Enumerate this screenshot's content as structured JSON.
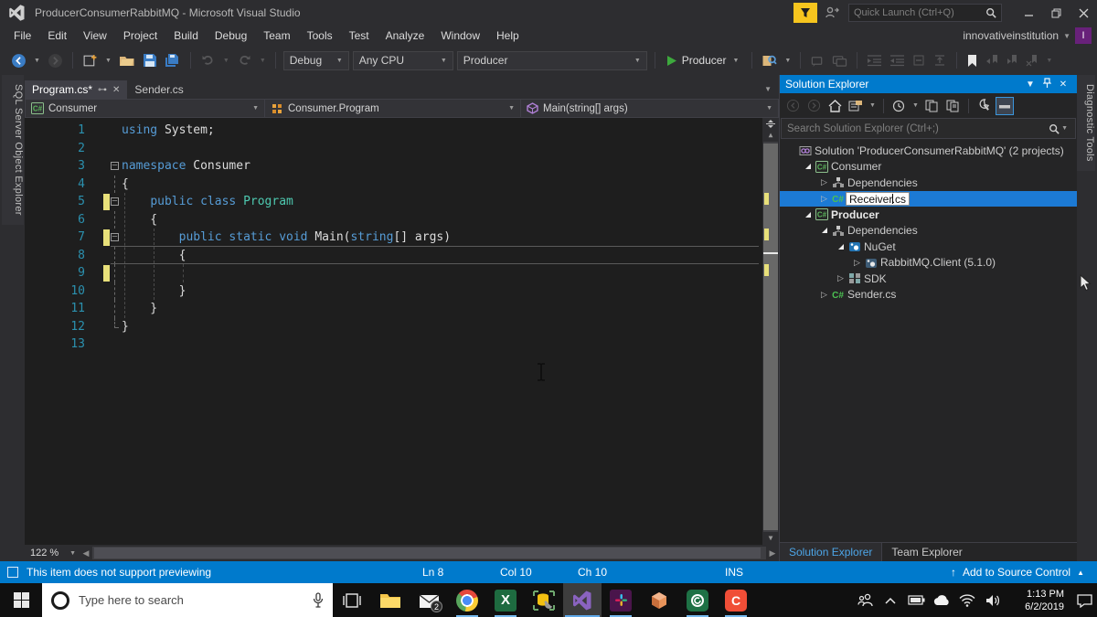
{
  "colors": {
    "accent_blue": "#007ACC",
    "selection_blue": "#1C7AD4",
    "keyword": "#569CD6",
    "type_name": "#4EC9B0",
    "line_number": "#2B91AF",
    "change_bar": "#E8E07A",
    "editor_bg": "#1E1E1E"
  },
  "title_bar": {
    "app_title": "ProducerConsumerRabbitMQ - Microsoft Visual Studio",
    "quick_launch_placeholder": "Quick Launch (Ctrl+Q)"
  },
  "menu_bar": {
    "items": [
      "File",
      "Edit",
      "View",
      "Project",
      "Build",
      "Debug",
      "Team",
      "Tools",
      "Test",
      "Analyze",
      "Window",
      "Help"
    ],
    "account": "innovativeinstitution",
    "avatar_letter": "I"
  },
  "toolbar": {
    "configuration": "Debug",
    "platform": "Any CPU",
    "startup_project": "Producer",
    "run_button": "Producer"
  },
  "left_strip": {
    "tab": "SQL Server Object Explorer"
  },
  "right_strip": {
    "tab": "Diagnostic Tools"
  },
  "editor": {
    "tabs": [
      {
        "label": "Program.cs*",
        "active": true
      },
      {
        "label": "Sender.cs",
        "active": false
      }
    ],
    "navbar": {
      "project": "Consumer",
      "type": "Consumer.Program",
      "member": "Main(string[] args)"
    },
    "zoom_level": "122 %",
    "code": {
      "lines": [
        {
          "n": 1,
          "fold": "",
          "changed": false,
          "current": false,
          "segments": [
            {
              "t": "using ",
              "c": "kw"
            },
            {
              "t": "System;",
              "c": "pl"
            }
          ]
        },
        {
          "n": 2,
          "fold": "",
          "changed": false,
          "current": false,
          "segments": []
        },
        {
          "n": 3,
          "fold": "box",
          "changed": false,
          "current": false,
          "segments": [
            {
              "t": "namespace ",
              "c": "kw"
            },
            {
              "t": "Consumer",
              "c": "pl"
            }
          ]
        },
        {
          "n": 4,
          "fold": "line",
          "changed": false,
          "current": false,
          "segments": [
            {
              "t": "{",
              "c": "pl"
            }
          ]
        },
        {
          "n": 5,
          "fold": "box",
          "changed": true,
          "current": false,
          "segments": [
            {
              "t": "    ",
              "c": "pl"
            },
            {
              "t": "public class ",
              "c": "kw"
            },
            {
              "t": "Program",
              "c": "ty"
            }
          ]
        },
        {
          "n": 6,
          "fold": "line",
          "changed": false,
          "current": false,
          "segments": [
            {
              "t": "    {",
              "c": "pl"
            }
          ]
        },
        {
          "n": 7,
          "fold": "box",
          "changed": true,
          "current": false,
          "segments": [
            {
              "t": "        ",
              "c": "pl"
            },
            {
              "t": "public static void ",
              "c": "kw"
            },
            {
              "t": "Main(",
              "c": "pl"
            },
            {
              "t": "string",
              "c": "kw"
            },
            {
              "t": "[] args)",
              "c": "pl"
            }
          ]
        },
        {
          "n": 8,
          "fold": "line",
          "changed": false,
          "current": true,
          "segments": [
            {
              "t": "        {",
              "c": "pl"
            }
          ]
        },
        {
          "n": 9,
          "fold": "line",
          "changed": true,
          "current": false,
          "segments": []
        },
        {
          "n": 10,
          "fold": "line",
          "changed": false,
          "current": false,
          "segments": [
            {
              "t": "        }",
              "c": "pl"
            }
          ]
        },
        {
          "n": 11,
          "fold": "line",
          "changed": false,
          "current": false,
          "segments": [
            {
              "t": "    }",
              "c": "pl"
            }
          ]
        },
        {
          "n": 12,
          "fold": "end",
          "changed": false,
          "current": false,
          "segments": [
            {
              "t": "}",
              "c": "pl"
            }
          ]
        },
        {
          "n": 13,
          "fold": "",
          "changed": false,
          "current": false,
          "segments": []
        }
      ]
    }
  },
  "solution_explorer": {
    "title": "Solution Explorer",
    "search_placeholder": "Search Solution Explorer (Ctrl+;)",
    "tree": [
      {
        "label": "Solution 'ProducerConsumerRabbitMQ' (2 projects)",
        "indent": 0,
        "arrow": "none",
        "icon": "solution",
        "selected": false,
        "editing": false,
        "bold": false
      },
      {
        "label": "Consumer",
        "indent": 1,
        "arrow": "expanded",
        "icon": "csproj",
        "selected": false,
        "editing": false,
        "bold": false
      },
      {
        "label": "Dependencies",
        "indent": 2,
        "arrow": "collapsed",
        "icon": "dependencies",
        "selected": false,
        "editing": false,
        "bold": false
      },
      {
        "label": "Receiver.cs",
        "indent": 2,
        "arrow": "collapsed",
        "icon": "csfile",
        "selected": true,
        "editing": true,
        "bold": false
      },
      {
        "label": "Producer",
        "indent": 1,
        "arrow": "expanded",
        "icon": "csproj",
        "selected": false,
        "editing": false,
        "bold": true
      },
      {
        "label": "Dependencies",
        "indent": 2,
        "arrow": "expanded",
        "icon": "dependencies",
        "selected": false,
        "editing": false,
        "bold": false
      },
      {
        "label": "NuGet",
        "indent": 3,
        "arrow": "expanded",
        "icon": "nuget",
        "selected": false,
        "editing": false,
        "bold": false
      },
      {
        "label": "RabbitMQ.Client (5.1.0)",
        "indent": 4,
        "arrow": "collapsed",
        "icon": "package",
        "selected": false,
        "editing": false,
        "bold": false
      },
      {
        "label": "SDK",
        "indent": 3,
        "arrow": "collapsed",
        "icon": "sdk",
        "selected": false,
        "editing": false,
        "bold": false
      },
      {
        "label": "Sender.cs",
        "indent": 2,
        "arrow": "collapsed",
        "icon": "csfile",
        "selected": false,
        "editing": false,
        "bold": false
      }
    ],
    "bottom_tabs": [
      {
        "label": "Solution Explorer",
        "active": true
      },
      {
        "label": "Team Explorer",
        "active": false
      }
    ]
  },
  "status_bar": {
    "message": "This item does not support previewing",
    "line": "Ln 8",
    "column": "Col 10",
    "character": "Ch 10",
    "mode": "INS",
    "source_control": "Add to Source Control"
  },
  "taskbar": {
    "search_placeholder": "Type here to search",
    "mail_badge": "2",
    "time": "1:13 PM",
    "date": "6/2/2019"
  }
}
